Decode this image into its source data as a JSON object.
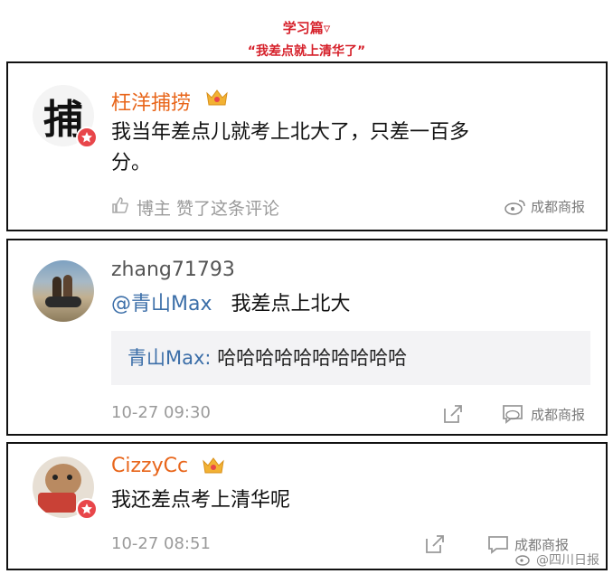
{
  "header": {
    "title": "学习篇▿",
    "subtitle": "“我差点就上清华了”"
  },
  "card1": {
    "avatar_text": "捕",
    "username": "枉洋捕捞",
    "comment_line1": "我当年差点儿就考上北大了，只差一百多",
    "comment_line2": "分。",
    "liked_by": "博主 赞了这条评论",
    "watermark": "成都商报"
  },
  "card2": {
    "username": "zhang71793",
    "mention": "@青山Max",
    "comment": "我差点上北大",
    "quote_name": "青山Max:",
    "quote_text": "哈哈哈哈哈哈哈哈哈哈",
    "timestamp": "10-27 09:30",
    "watermark": "成都商报"
  },
  "card3": {
    "username": "CizzyCc",
    "comment": "我还差点考上清华呢",
    "timestamp": "10-27 08:51",
    "watermark": "成都商报",
    "bottom_watermark": "@四川日报"
  },
  "colors": {
    "header": "#d6202a",
    "username_orange": "#e8661b",
    "mention_blue": "#3b6ea8",
    "meta_gray": "#9a9a9a",
    "verified_red": "#e8464a",
    "crown_gold": "#f2b233"
  },
  "icons": [
    "crown-icon",
    "verified-badge-icon",
    "like-icon",
    "share-icon",
    "comment-icon",
    "weibo-logo-icon"
  ]
}
